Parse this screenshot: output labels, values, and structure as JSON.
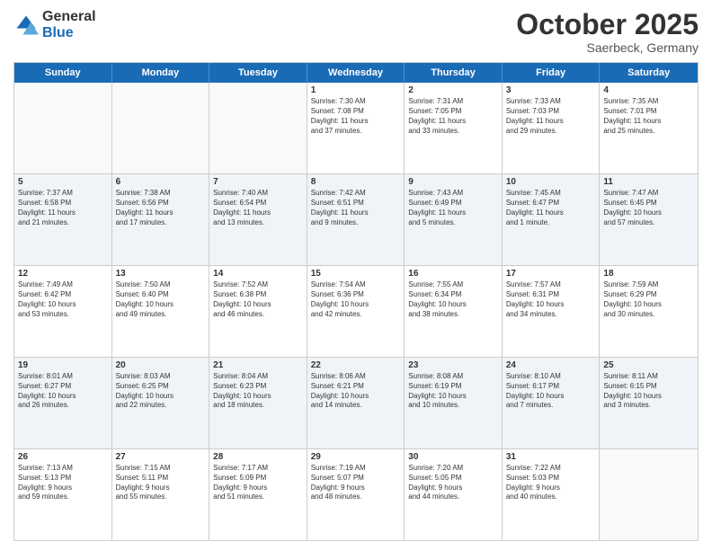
{
  "logo": {
    "general": "General",
    "blue": "Blue"
  },
  "title": "October 2025",
  "subtitle": "Saerbeck, Germany",
  "header_days": [
    "Sunday",
    "Monday",
    "Tuesday",
    "Wednesday",
    "Thursday",
    "Friday",
    "Saturday"
  ],
  "rows": [
    [
      {
        "day": "",
        "text": ""
      },
      {
        "day": "",
        "text": ""
      },
      {
        "day": "",
        "text": ""
      },
      {
        "day": "1",
        "text": "Sunrise: 7:30 AM\nSunset: 7:08 PM\nDaylight: 11 hours\nand 37 minutes."
      },
      {
        "day": "2",
        "text": "Sunrise: 7:31 AM\nSunset: 7:05 PM\nDaylight: 11 hours\nand 33 minutes."
      },
      {
        "day": "3",
        "text": "Sunrise: 7:33 AM\nSunset: 7:03 PM\nDaylight: 11 hours\nand 29 minutes."
      },
      {
        "day": "4",
        "text": "Sunrise: 7:35 AM\nSunset: 7:01 PM\nDaylight: 11 hours\nand 25 minutes."
      }
    ],
    [
      {
        "day": "5",
        "text": "Sunrise: 7:37 AM\nSunset: 6:58 PM\nDaylight: 11 hours\nand 21 minutes."
      },
      {
        "day": "6",
        "text": "Sunrise: 7:38 AM\nSunset: 6:56 PM\nDaylight: 11 hours\nand 17 minutes."
      },
      {
        "day": "7",
        "text": "Sunrise: 7:40 AM\nSunset: 6:54 PM\nDaylight: 11 hours\nand 13 minutes."
      },
      {
        "day": "8",
        "text": "Sunrise: 7:42 AM\nSunset: 6:51 PM\nDaylight: 11 hours\nand 9 minutes."
      },
      {
        "day": "9",
        "text": "Sunrise: 7:43 AM\nSunset: 6:49 PM\nDaylight: 11 hours\nand 5 minutes."
      },
      {
        "day": "10",
        "text": "Sunrise: 7:45 AM\nSunset: 6:47 PM\nDaylight: 11 hours\nand 1 minute."
      },
      {
        "day": "11",
        "text": "Sunrise: 7:47 AM\nSunset: 6:45 PM\nDaylight: 10 hours\nand 57 minutes."
      }
    ],
    [
      {
        "day": "12",
        "text": "Sunrise: 7:49 AM\nSunset: 6:42 PM\nDaylight: 10 hours\nand 53 minutes."
      },
      {
        "day": "13",
        "text": "Sunrise: 7:50 AM\nSunset: 6:40 PM\nDaylight: 10 hours\nand 49 minutes."
      },
      {
        "day": "14",
        "text": "Sunrise: 7:52 AM\nSunset: 6:38 PM\nDaylight: 10 hours\nand 46 minutes."
      },
      {
        "day": "15",
        "text": "Sunrise: 7:54 AM\nSunset: 6:36 PM\nDaylight: 10 hours\nand 42 minutes."
      },
      {
        "day": "16",
        "text": "Sunrise: 7:55 AM\nSunset: 6:34 PM\nDaylight: 10 hours\nand 38 minutes."
      },
      {
        "day": "17",
        "text": "Sunrise: 7:57 AM\nSunset: 6:31 PM\nDaylight: 10 hours\nand 34 minutes."
      },
      {
        "day": "18",
        "text": "Sunrise: 7:59 AM\nSunset: 6:29 PM\nDaylight: 10 hours\nand 30 minutes."
      }
    ],
    [
      {
        "day": "19",
        "text": "Sunrise: 8:01 AM\nSunset: 6:27 PM\nDaylight: 10 hours\nand 26 minutes."
      },
      {
        "day": "20",
        "text": "Sunrise: 8:03 AM\nSunset: 6:25 PM\nDaylight: 10 hours\nand 22 minutes."
      },
      {
        "day": "21",
        "text": "Sunrise: 8:04 AM\nSunset: 6:23 PM\nDaylight: 10 hours\nand 18 minutes."
      },
      {
        "day": "22",
        "text": "Sunrise: 8:06 AM\nSunset: 6:21 PM\nDaylight: 10 hours\nand 14 minutes."
      },
      {
        "day": "23",
        "text": "Sunrise: 8:08 AM\nSunset: 6:19 PM\nDaylight: 10 hours\nand 10 minutes."
      },
      {
        "day": "24",
        "text": "Sunrise: 8:10 AM\nSunset: 6:17 PM\nDaylight: 10 hours\nand 7 minutes."
      },
      {
        "day": "25",
        "text": "Sunrise: 8:11 AM\nSunset: 6:15 PM\nDaylight: 10 hours\nand 3 minutes."
      }
    ],
    [
      {
        "day": "26",
        "text": "Sunrise: 7:13 AM\nSunset: 5:13 PM\nDaylight: 9 hours\nand 59 minutes."
      },
      {
        "day": "27",
        "text": "Sunrise: 7:15 AM\nSunset: 5:11 PM\nDaylight: 9 hours\nand 55 minutes."
      },
      {
        "day": "28",
        "text": "Sunrise: 7:17 AM\nSunset: 5:09 PM\nDaylight: 9 hours\nand 51 minutes."
      },
      {
        "day": "29",
        "text": "Sunrise: 7:19 AM\nSunset: 5:07 PM\nDaylight: 9 hours\nand 48 minutes."
      },
      {
        "day": "30",
        "text": "Sunrise: 7:20 AM\nSunset: 5:05 PM\nDaylight: 9 hours\nand 44 minutes."
      },
      {
        "day": "31",
        "text": "Sunrise: 7:22 AM\nSunset: 5:03 PM\nDaylight: 9 hours\nand 40 minutes."
      },
      {
        "day": "",
        "text": ""
      }
    ]
  ]
}
